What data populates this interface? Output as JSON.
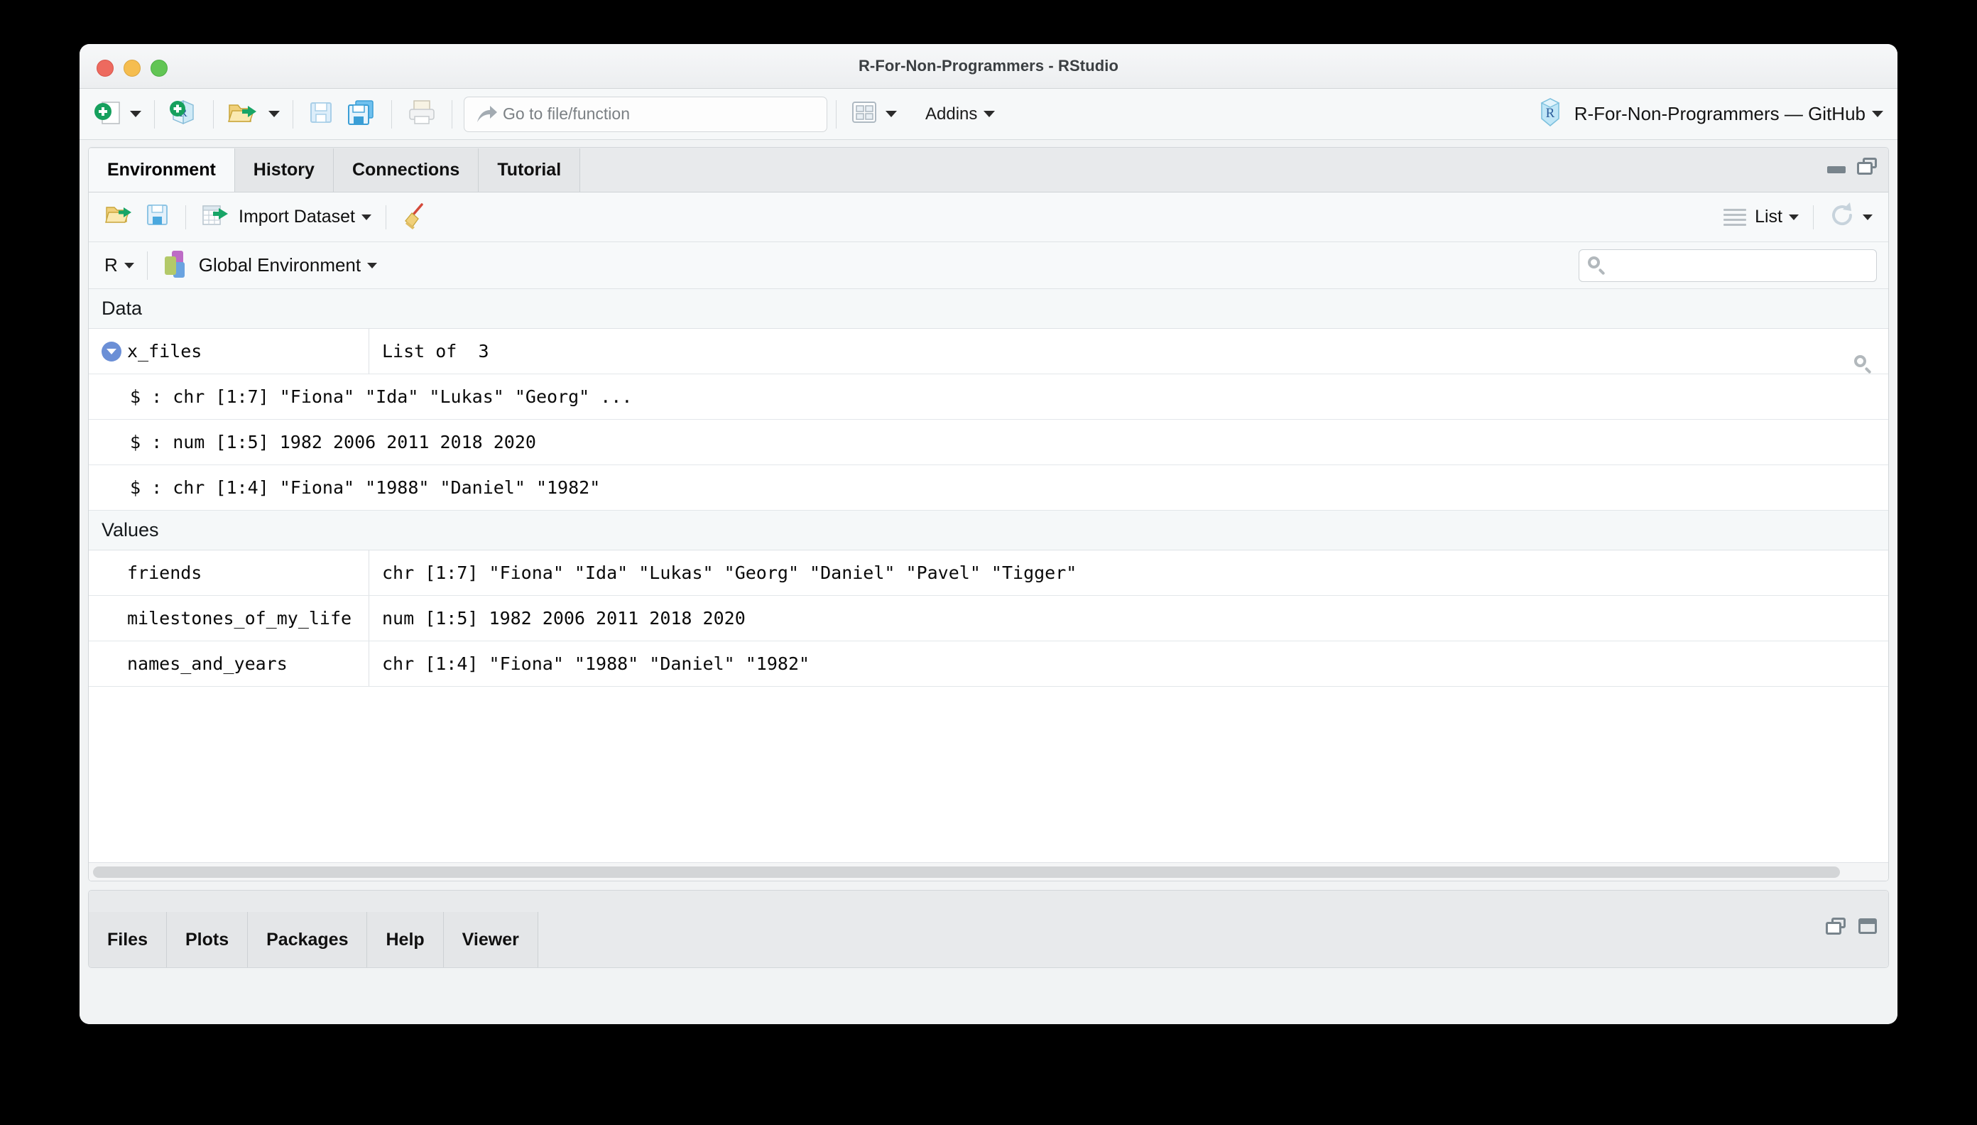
{
  "window": {
    "title": "R-For-Non-Programmers - RStudio",
    "traffic_lights": [
      "close",
      "minimize",
      "zoom"
    ]
  },
  "main_toolbar": {
    "new_file_label": "new-file",
    "new_project_label": "new-project",
    "open_file_label": "open-file",
    "save_label": "save",
    "save_all_label": "save-all",
    "print_label": "print",
    "goto_placeholder": "Go to file/function",
    "panes_label": "workspace-panes",
    "addins_label": "Addins",
    "project_label": "R-For-Non-Programmers — GitHub"
  },
  "env_pane": {
    "tabs": [
      {
        "label": "Environment",
        "active": true
      },
      {
        "label": "History",
        "active": false
      },
      {
        "label": "Connections",
        "active": false
      },
      {
        "label": "Tutorial",
        "active": false
      }
    ],
    "toolbar": {
      "load_workspace_label": "load-workspace",
      "save_workspace_label": "save-workspace",
      "import_label": "Import Dataset",
      "broom_label": "clear-objects",
      "view_mode_label": "List",
      "refresh_label": "refresh"
    },
    "scope": {
      "language": "R",
      "environment": "Global Environment",
      "search_placeholder": ""
    },
    "groups": [
      {
        "title": "Data",
        "rows": [
          {
            "kind": "object",
            "expandable": true,
            "expanded": true,
            "name": "x_files",
            "value": "List of  3",
            "has_viewer_icon": true
          },
          {
            "kind": "detail",
            "text": "$ : chr [1:7] \"Fiona\" \"Ida\" \"Lukas\" \"Georg\" ..."
          },
          {
            "kind": "detail",
            "text": "$ : num [1:5] 1982 2006 2011 2018 2020"
          },
          {
            "kind": "detail",
            "text": "$ : chr [1:4] \"Fiona\" \"1988\" \"Daniel\" \"1982\""
          }
        ]
      },
      {
        "title": "Values",
        "rows": [
          {
            "kind": "object",
            "expandable": false,
            "name": "friends",
            "value": "chr [1:7] \"Fiona\" \"Ida\" \"Lukas\" \"Georg\" \"Daniel\" \"Pavel\" \"Tigger\""
          },
          {
            "kind": "object",
            "expandable": false,
            "name": "milestones_of_my_life",
            "value": "num [1:5] 1982 2006 2011 2018 2020"
          },
          {
            "kind": "object",
            "expandable": false,
            "name": "names_and_years",
            "value": "chr [1:4] \"Fiona\" \"1988\" \"Daniel\" \"1982\""
          }
        ]
      }
    ]
  },
  "files_pane": {
    "tabs": [
      {
        "label": "Files",
        "active": false
      },
      {
        "label": "Plots",
        "active": false
      },
      {
        "label": "Packages",
        "active": false
      },
      {
        "label": "Help",
        "active": false
      },
      {
        "label": "Viewer",
        "active": false
      }
    ]
  },
  "colors": {
    "accent_blue": "#6b8fd6",
    "green_plus": "#16a05d",
    "folder_yellow": "#e8c057",
    "window_chrome": "#eceef0",
    "pane_bg": "#f1f3f4"
  }
}
